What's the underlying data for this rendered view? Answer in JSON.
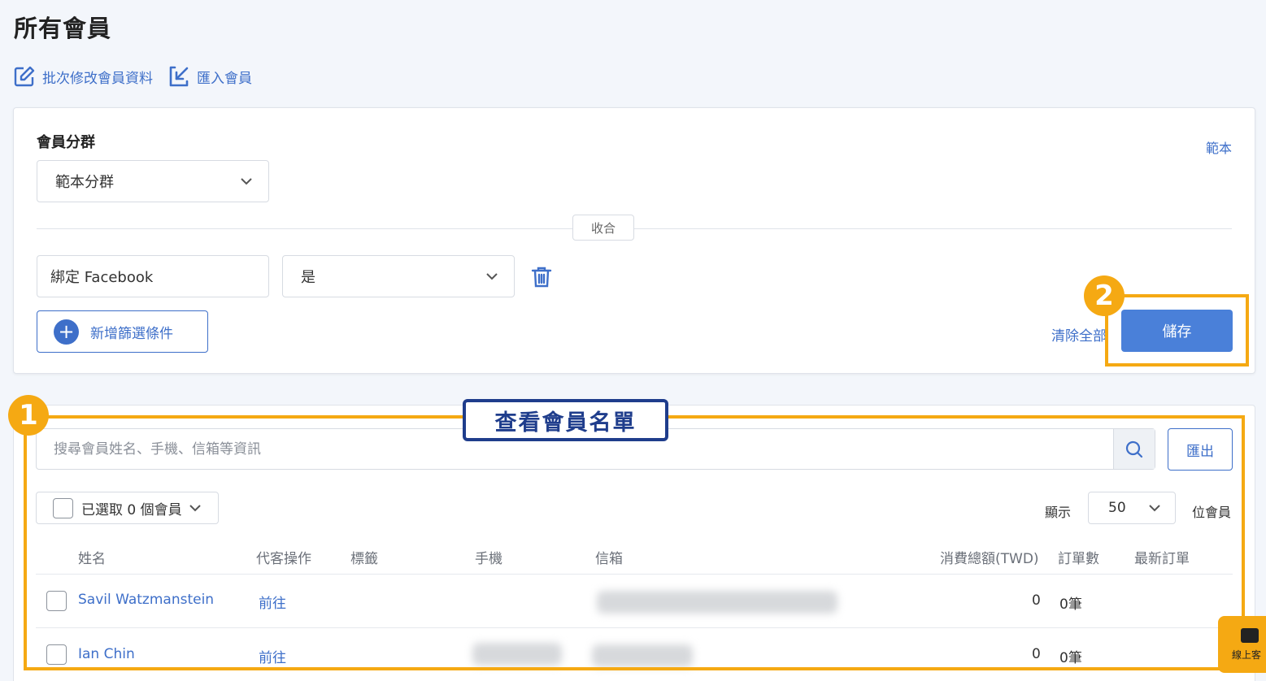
{
  "page": {
    "title": "所有會員"
  },
  "actions": {
    "bulk_edit": "批次修改會員資料",
    "import": "匯入會員"
  },
  "filter": {
    "segment_label": "會員分群",
    "template_link": "範本",
    "segment_value": "範本分群",
    "collapse_label": "收合",
    "condition_field": "綁定 Facebook",
    "condition_value": "是",
    "add_condition": "新增篩選條件",
    "clear_all": "清除全部",
    "save": "儲存"
  },
  "annotations": {
    "badge_1": "1",
    "badge_2": "2",
    "callout": "查看會員名單"
  },
  "list": {
    "search_placeholder": "搜尋會員姓名、手機、信箱等資訊",
    "export": "匯出",
    "selected_label": "已選取 0 個會員",
    "show_label": "顯示",
    "per_page": "50",
    "unit_label": "位會員",
    "columns": [
      "姓名",
      "代客操作",
      "標籤",
      "手機",
      "信箱",
      "消費總額(TWD)",
      "訂單數",
      "最新訂單"
    ],
    "rows": [
      {
        "name": "Savil Watzmanstein",
        "action": "前往",
        "total": "0",
        "orders": "0筆"
      },
      {
        "name": "Ian Chin",
        "action": "前往",
        "total": "0",
        "orders": "0筆"
      }
    ]
  },
  "chat": {
    "label": "線上客"
  },
  "colors": {
    "accent": "#3e6fc9",
    "highlight": "#f5a913",
    "callout_border": "#1f3d8c"
  }
}
